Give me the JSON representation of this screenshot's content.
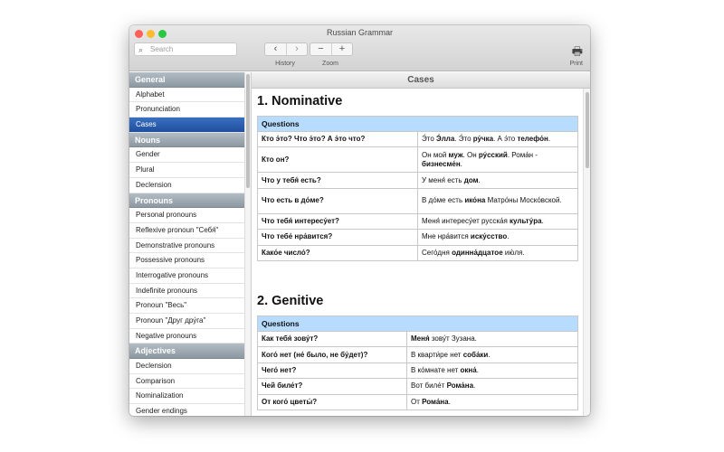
{
  "window": {
    "title": "Russian Grammar",
    "colors": {
      "close": "#fe5f57",
      "min": "#febc2e",
      "max": "#28c840",
      "selection": "#2a5cad",
      "section_header": "#98a3ac",
      "table_header": "#b7dcff"
    }
  },
  "toolbar": {
    "search_placeholder": "Search",
    "history_label": "History",
    "zoom_label": "Zoom",
    "print_label": "Print",
    "back_icon": "‹",
    "forward_icon": "›",
    "zoom_out_icon": "−",
    "zoom_in_icon": "+",
    "print_icon": "🖶"
  },
  "sidebar": [
    {
      "header": "General",
      "items": [
        "Alphabet",
        "Pronunciation",
        "Cases"
      ]
    },
    {
      "header": "Nouns",
      "items": [
        "Gender",
        "Plural",
        "Declension"
      ]
    },
    {
      "header": "Pronouns",
      "items": [
        "Personal pronouns",
        "Reflexive pronoun \"Себя́\"",
        "Demonstrative pronouns",
        "Possessive pronouns",
        "Interrogative pronouns",
        "Indefinite pronouns",
        "Pronoun \"Весь\"",
        "Pronoun \"Друг дру́га\"",
        "Negative pronouns"
      ]
    },
    {
      "header": "Adjectives",
      "items": [
        "Declension",
        "Comparison",
        "Nominalization",
        "Gender endings"
      ]
    }
  ],
  "selected_item": "Cases",
  "content": {
    "header": "Cases",
    "sections": [
      {
        "title": "1. Nominative",
        "table_header": "Questions",
        "rows": [
          {
            "q": "Кто э́то? Что э́то? А э́то что?",
            "a": [
              {
                "t": "Э́то "
              },
              {
                "t": "Э́лла",
                "b": true
              },
              {
                "t": ". Э́то "
              },
              {
                "t": "ру́чка",
                "b": true
              },
              {
                "t": ". А э́то "
              },
              {
                "t": "телефо́н",
                "b": true
              },
              {
                "t": "."
              }
            ]
          },
          {
            "q": "Кто он?",
            "a": [
              {
                "t": "Он мой "
              },
              {
                "t": "муж",
                "b": true
              },
              {
                "t": ". Он "
              },
              {
                "t": "ру́сский",
                "b": true
              },
              {
                "t": ". Рома́н - "
              },
              {
                "t": "бизнесме́н",
                "b": true
              },
              {
                "t": "."
              }
            ]
          },
          {
            "q": "Что у тебя́ есть?",
            "a": [
              {
                "t": "У меня́ есть "
              },
              {
                "t": "дом",
                "b": true
              },
              {
                "t": "."
              }
            ]
          },
          {
            "q": "Что есть в до́ме?",
            "a": [
              {
                "t": "В до́ме есть "
              },
              {
                "t": "ико́на",
                "b": true
              },
              {
                "t": " Матро́ны Моско́вской."
              }
            ]
          },
          {
            "q": "Что тебя́ интересу́ет?",
            "a": [
              {
                "t": "Меня́ интересу́ет русска́я "
              },
              {
                "t": "культу́ра",
                "b": true
              },
              {
                "t": "."
              }
            ]
          },
          {
            "q": "Что тебе́ нра́вится?",
            "a": [
              {
                "t": "Мне нра́вится "
              },
              {
                "t": "иску́сство",
                "b": true
              },
              {
                "t": "."
              }
            ]
          },
          {
            "q": "Како́е число́?",
            "a": [
              {
                "t": "Сего́дня "
              },
              {
                "t": "одинна́дцатое",
                "b": true
              },
              {
                "t": " ию́ля."
              }
            ]
          }
        ]
      },
      {
        "title": "2. Genitive",
        "table_header": "Questions",
        "rows": [
          {
            "q": "Как тебя́ зову́т?",
            "a": [
              {
                "t": "Меня́",
                "b": true
              },
              {
                "t": " зову́т Зузана."
              }
            ]
          },
          {
            "q": "Кого́ нет (не́ было, не бу́дет)?",
            "a": [
              {
                "t": "В кварти́ре нет "
              },
              {
                "t": "соба́ки",
                "b": true
              },
              {
                "t": "."
              }
            ]
          },
          {
            "q": "Чего́ нет?",
            "a": [
              {
                "t": "В ко́мнате нет "
              },
              {
                "t": "окна́",
                "b": true
              },
              {
                "t": "."
              }
            ]
          },
          {
            "q": "Чей биле́т?",
            "a": [
              {
                "t": "Вот биле́т "
              },
              {
                "t": "Рома́на",
                "b": true
              },
              {
                "t": "."
              }
            ]
          },
          {
            "q": "От кого́ цветы́?",
            "a": [
              {
                "t": "От "
              },
              {
                "t": "Рома́на",
                "b": true
              },
              {
                "t": "."
              }
            ]
          }
        ]
      }
    ]
  }
}
